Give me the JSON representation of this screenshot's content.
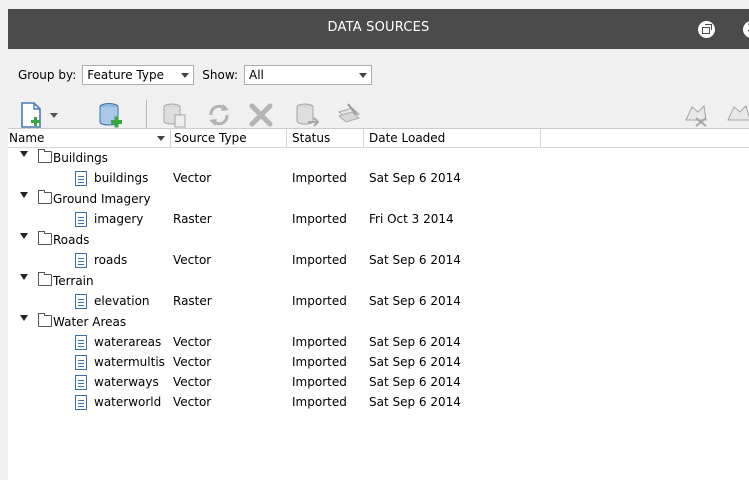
{
  "window": {
    "title": "DATA SOURCES"
  },
  "group_by": {
    "label": "Group by:",
    "value": "Feature Type"
  },
  "show": {
    "label": "Show:",
    "value": "All"
  },
  "toolbar": {
    "icons": [
      "new-document-icon",
      "add-datasource-icon",
      "datasource-properties-icon",
      "refresh-icon",
      "remove-icon",
      "export-icon",
      "edit-icon",
      "clear-features-icon",
      "features-icon"
    ]
  },
  "columns": {
    "name": "Name",
    "source_type": "Source Type",
    "status": "Status",
    "date_loaded": "Date Loaded"
  },
  "groups": [
    {
      "name": "Buildings",
      "items": [
        {
          "name": "buildings",
          "type": "Vector",
          "status": "Imported",
          "date": "Sat Sep 6 2014"
        }
      ]
    },
    {
      "name": "Ground Imagery",
      "items": [
        {
          "name": "imagery",
          "type": "Raster",
          "status": "Imported",
          "date": "Fri Oct 3 2014"
        }
      ]
    },
    {
      "name": "Roads",
      "items": [
        {
          "name": "roads",
          "type": "Vector",
          "status": "Imported",
          "date": "Sat Sep 6 2014"
        }
      ]
    },
    {
      "name": "Terrain",
      "items": [
        {
          "name": "elevation",
          "type": "Raster",
          "status": "Imported",
          "date": "Sat Sep 6 2014"
        }
      ]
    },
    {
      "name": "Water Areas",
      "items": [
        {
          "name": "waterareas",
          "type": "Vector",
          "status": "Imported",
          "date": "Sat Sep 6 2014"
        },
        {
          "name": "watermultis",
          "type": "Vector",
          "status": "Imported",
          "date": "Sat Sep 6 2014"
        },
        {
          "name": "waterways",
          "type": "Vector",
          "status": "Imported",
          "date": "Sat Sep 6 2014"
        },
        {
          "name": "waterworld",
          "type": "Vector",
          "status": "Imported",
          "date": "Sat Sep 6 2014"
        }
      ]
    }
  ]
}
